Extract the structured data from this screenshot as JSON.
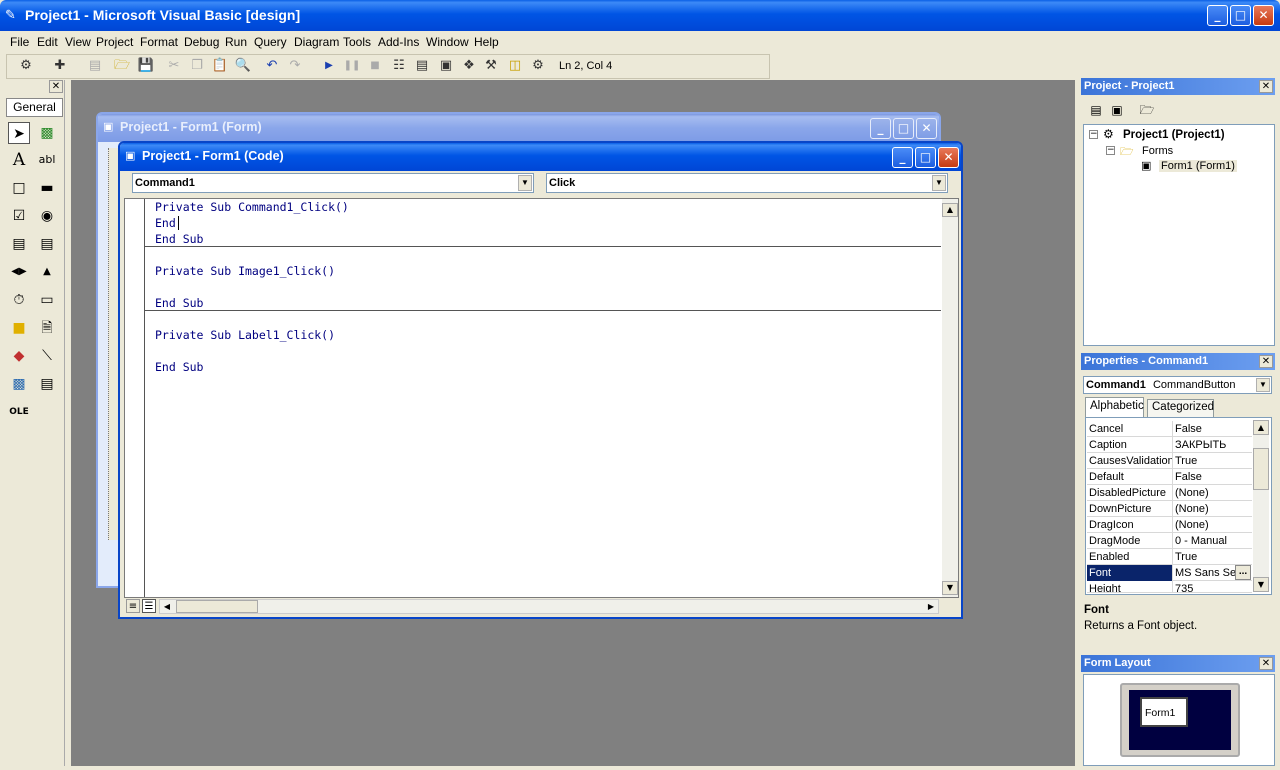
{
  "app": {
    "title": "Project1 - Microsoft Visual Basic [design]"
  },
  "menu": [
    "File",
    "Edit",
    "View",
    "Project",
    "Format",
    "Debug",
    "Run",
    "Query",
    "Diagram",
    "Tools",
    "Add-Ins",
    "Window",
    "Help"
  ],
  "toolbar": {
    "position": "Ln 2, Col 4"
  },
  "toolbox": {
    "tab": "General"
  },
  "form_window": {
    "title": "Project1 - Form1 (Form)"
  },
  "code_window": {
    "title": "Project1 - Form1 (Code)",
    "object_combo": "Command1",
    "proc_combo": "Click",
    "lines": [
      "Private Sub Command1_Click()",
      "End",
      "End Sub",
      "Private Sub Image1_Click()",
      "End Sub",
      "Private Sub Label1_Click()",
      "End Sub"
    ]
  },
  "project_panel": {
    "title": "Project - Project1",
    "root": "Project1 (Project1)",
    "folder": "Forms",
    "item": "Form1 (Form1)"
  },
  "properties_panel": {
    "title": "Properties - Command1",
    "object_name": "Command1",
    "object_type": "CommandButton",
    "tabs": [
      "Alphabetic",
      "Categorized"
    ],
    "rows": [
      {
        "name": "Cancel",
        "value": "False"
      },
      {
        "name": "Caption",
        "value": "ЗАКРЫТЬ"
      },
      {
        "name": "CausesValidation",
        "value": "True"
      },
      {
        "name": "Default",
        "value": "False"
      },
      {
        "name": "DisabledPicture",
        "value": "(None)"
      },
      {
        "name": "DownPicture",
        "value": "(None)"
      },
      {
        "name": "DragIcon",
        "value": "(None)"
      },
      {
        "name": "DragMode",
        "value": "0 - Manual"
      },
      {
        "name": "Enabled",
        "value": "True"
      },
      {
        "name": "Font",
        "value": "MS Sans Ser"
      },
      {
        "name": "Height",
        "value": "735"
      }
    ],
    "desc_title": "Font",
    "desc_text": "Returns a Font object."
  },
  "layout_panel": {
    "title": "Form Layout",
    "form_label": "Form1"
  },
  "colors": {
    "workspace": "#808080",
    "title_active": "#0055e5",
    "selection": "#0a246a",
    "code_keyword": "#000080"
  }
}
